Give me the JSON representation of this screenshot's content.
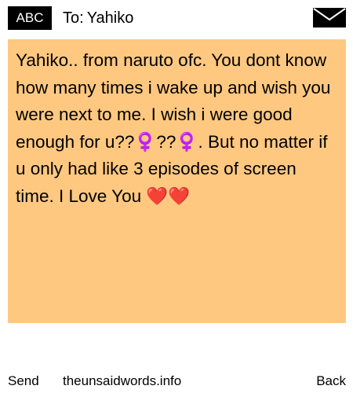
{
  "header": {
    "badge_label": "ABC",
    "to_prefix": "To:",
    "recipient": "Yahiko",
    "mail_icon": "envelope-icon"
  },
  "message": {
    "text": "Yahiko.. from naruto ofc. You dont know how many times i wake up and wish you were next to me. I wish i were good enough for u??‍♀️??‍♀️. But no matter if u only had like 3 episodes of screen time. I Love You ❤️❤️",
    "background_color": "#ffc880"
  },
  "footer": {
    "send_label": "Send",
    "site_label": "theunsaidwords.info",
    "back_label": "Back"
  }
}
